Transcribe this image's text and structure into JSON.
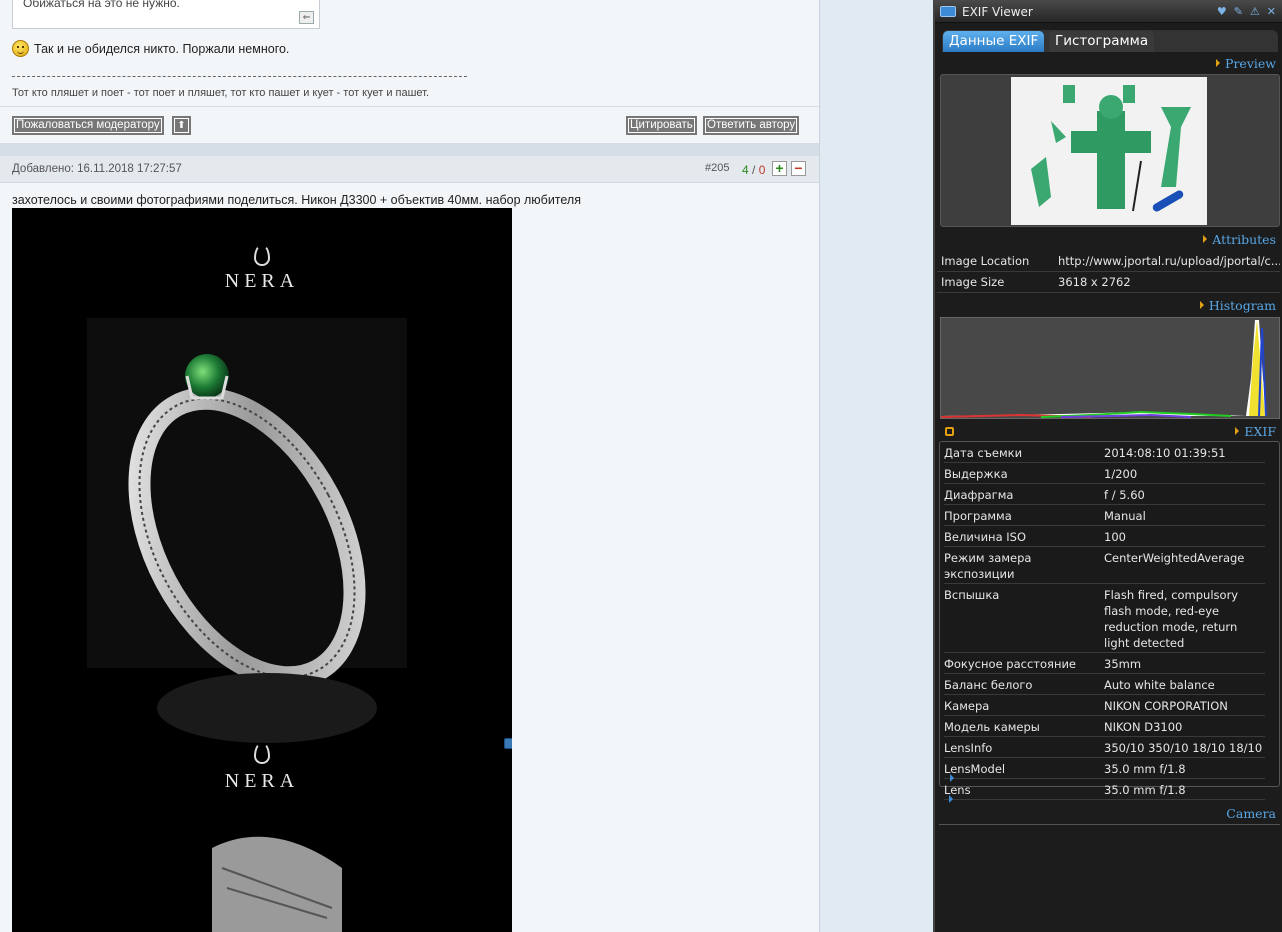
{
  "forum": {
    "quote_text": "Обижаться на это не нужно.",
    "smile_text": "Так и не обиделся никто. Поржали немного.",
    "signature": "Тот кто пляшет и поет - тот поет и пляшет, тот кто пашет и кует - тот кует и пашет.",
    "buttons": {
      "report": "Пожаловаться модератору",
      "quote": "Цитировать",
      "reply": "Ответить автору"
    },
    "post": {
      "date": "Добавлено: 16.11.2018 17:27:57",
      "number": "#205",
      "rating_plus": "4",
      "rating_sep": "/",
      "rating_minus": "0",
      "text": "захотелось и своими фотографиями поделиться. Никон Д3300 + объектив 40мм. набор любителя",
      "brand": "NERA"
    }
  },
  "viewer": {
    "title": "EXIF Viewer",
    "tabs": [
      "Данные EXIF",
      "Гистограмма"
    ],
    "sections": {
      "preview": "Preview",
      "attributes": "Attributes",
      "histogram": "Histogram",
      "exif": "EXIF",
      "camera": "Camera"
    },
    "attributes": [
      {
        "key": "Image Location",
        "value": "http://www.jportal.ru/upload/jportal/c..."
      },
      {
        "key": "Image Size",
        "value": "3618 x 2762"
      }
    ],
    "exif": [
      {
        "key": "Дата съемки",
        "value": "2014:08:10 01:39:51"
      },
      {
        "key": "Выдержка",
        "value": "1/200"
      },
      {
        "key": "Диафрагма",
        "value": "f / 5.60"
      },
      {
        "key": "Программа",
        "value": "Manual"
      },
      {
        "key": "Величина ISO",
        "value": "100"
      },
      {
        "key": "Режим замера экспозиции",
        "value": "CenterWeightedAverage"
      },
      {
        "key": "Вспышка",
        "value": "Flash fired, compulsory flash mode, red-eye reduction mode, return light detected"
      },
      {
        "key": "Фокусное расстояние",
        "value": "35mm"
      },
      {
        "key": "Баланс белого",
        "value": "Auto white balance"
      },
      {
        "key": "Камера",
        "value": "NIKON CORPORATION"
      },
      {
        "key": "Модель камеры",
        "value": "NIKON D3100"
      },
      {
        "key": "LensInfo",
        "value": "350/10 350/10 18/10 18/10"
      },
      {
        "key": "LensModel",
        "value": "35.0 mm f/1.8"
      },
      {
        "key": "Lens",
        "value": "35.0 mm f/1.8"
      }
    ],
    "colors": {
      "accent": "#58a7e6",
      "panel_bg": "#1c1c1c",
      "handle": "#e2a012"
    }
  }
}
